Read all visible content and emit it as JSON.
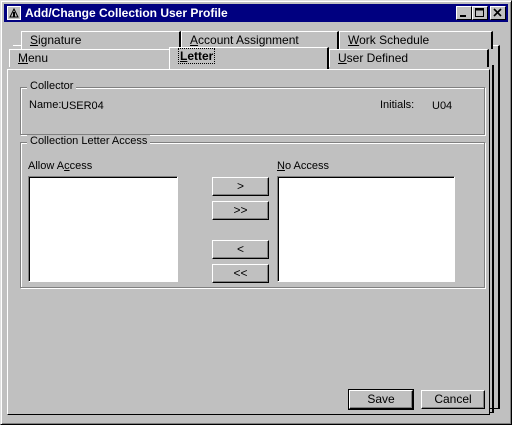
{
  "window": {
    "title": "Add/Change Collection User Profile",
    "title_icon": "scale-app-icon"
  },
  "titlebar_buttons": [
    "minimize-icon",
    "maximize-icon",
    "close-icon"
  ],
  "tabs_back_row": [
    {
      "label": "Signature"
    },
    {
      "label": "Account Assignment"
    },
    {
      "label": "Work Schedule"
    }
  ],
  "tabs_front_row": [
    {
      "label": "Menu"
    },
    {
      "label": "Letter",
      "active": true
    },
    {
      "label": "User Defined"
    }
  ],
  "collector": {
    "group_title": "Collector",
    "name_label": "Name:",
    "name_value": "USER04",
    "initials_label": "Initials:",
    "initials_value": "U04"
  },
  "letter_access": {
    "group_title": "Collection Letter Access",
    "allow_label": "Allow Access",
    "no_access_label": "No Access",
    "allow_items": [],
    "no_access_items": [],
    "move_right": ">",
    "move_all_right": ">>",
    "move_left": "<",
    "move_all_left": "<<"
  },
  "buttons": {
    "save": "Save",
    "cancel": "Cancel"
  },
  "colors": {
    "titlebar": "#000080",
    "face": "#c0c0c0"
  }
}
